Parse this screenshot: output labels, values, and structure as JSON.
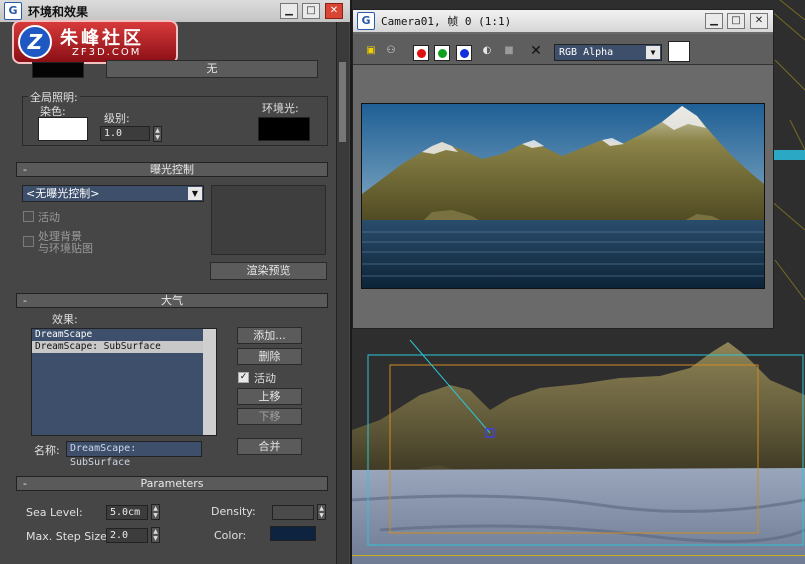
{
  "env_window": {
    "title": "环境和效果",
    "logo": {
      "brand": "朱峰社区",
      "url": "ZF3D.COM",
      "glyph": "Z"
    },
    "background": {
      "map_button": "无"
    },
    "global_lighting": {
      "group_label": "全局照明:",
      "tint_label": "染色:",
      "level_label": "级别:",
      "level_value": "1.0",
      "ambient_label": "环境光:",
      "tint_color": "#ffffff",
      "ambient_color": "#000000"
    },
    "exposure": {
      "header": "曝光控制",
      "dropdown_value": "<无曝光控制>",
      "active_label": "活动",
      "process_bg_label_1": "处理背景",
      "process_bg_label_2": "与环境贴图",
      "render_preview_button": "渲染预览"
    },
    "atmosphere": {
      "header": "大气",
      "effects_label": "效果:",
      "effects": [
        "DreamScape",
        "DreamScape: SubSurface"
      ],
      "selected_index": 1,
      "add_button": "添加...",
      "delete_button": "删除",
      "active_label": "活动",
      "active_checked": true,
      "move_up_button": "上移",
      "move_down_button": "下移",
      "name_label": "名称:",
      "name_value": "DreamScape: SubSurface",
      "merge_button": "合并"
    },
    "parameters": {
      "header": "Parameters",
      "sea_level_label": "Sea Level:",
      "sea_level_value": "5.0cm",
      "density_label": "Density:",
      "max_step_label": "Max. Step Size:",
      "max_step_value": "2.0",
      "color_label": "Color:",
      "color_value": "#0e2340"
    }
  },
  "camera_window": {
    "title": "Camera01, 帧 0 (1:1)",
    "channel_value": "RGB Alpha",
    "channel_colors": {
      "red": "#e01010",
      "green": "#10a020",
      "blue": "#1030e0"
    }
  },
  "icons": [
    "app-icon",
    "save-icon",
    "clone-icon",
    "red-channel-icon",
    "green-channel-icon",
    "blue-channel-icon",
    "mono-icon",
    "clear-icon",
    "close-x-icon",
    "chevron-down-icon",
    "minimize-icon",
    "maximize-icon",
    "close-icon"
  ]
}
